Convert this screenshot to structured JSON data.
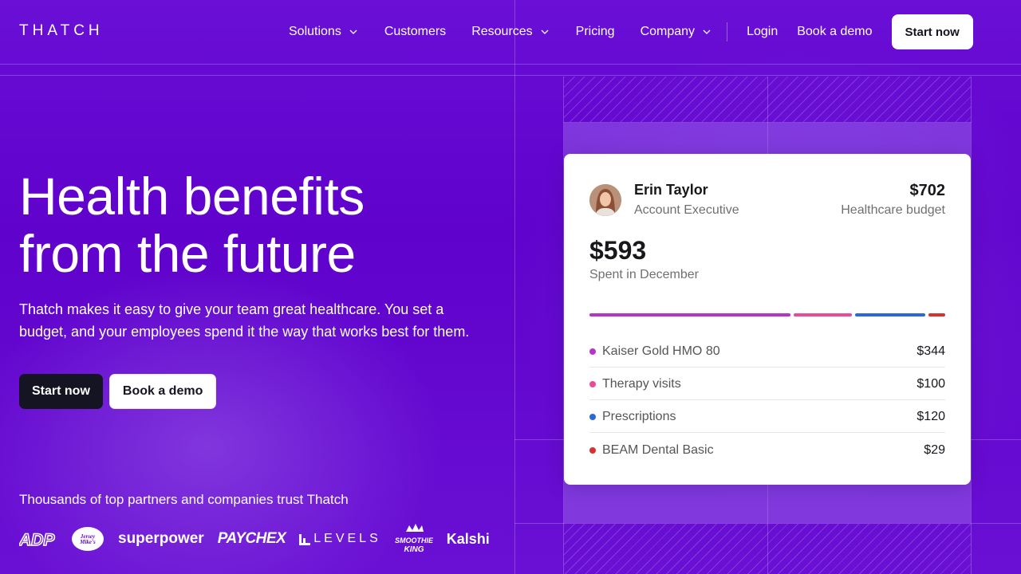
{
  "header": {
    "logo": "THATCH",
    "nav": [
      {
        "label": "Solutions",
        "dropdown": true
      },
      {
        "label": "Customers",
        "dropdown": false
      },
      {
        "label": "Resources",
        "dropdown": true
      },
      {
        "label": "Pricing",
        "dropdown": false
      },
      {
        "label": "Company",
        "dropdown": true
      }
    ],
    "login": "Login",
    "book_demo": "Book a demo",
    "start_now": "Start now"
  },
  "hero": {
    "title_line1": "Health benefits",
    "title_line2": "from the future",
    "subtitle": "Thatch makes it easy to give your team great healthcare. You set a budget, and your employees spend it the way that works best for them.",
    "primary_cta": "Start now",
    "secondary_cta": "Book a demo"
  },
  "trust": {
    "text": "Thousands of top partners and companies trust Thatch",
    "logos": [
      "ADP",
      "Jersey Mike's Subs",
      "superpower",
      "PAYCHEX",
      "LEVELS",
      "Smoothie King",
      "Kalshi"
    ]
  },
  "card": {
    "name": "Erin Taylor",
    "role": "Account Executive",
    "budget_value": "$702",
    "budget_label": "Healthcare budget",
    "spent_value": "$593",
    "spent_label": "Spent in December",
    "items": [
      {
        "label": "Kaiser Gold HMO 80",
        "value": "$344",
        "amount": 344,
        "color": "#b535c9"
      },
      {
        "label": "Therapy visits",
        "value": "$100",
        "amount": 100,
        "color": "#e64c97"
      },
      {
        "label": "Prescriptions",
        "value": "$120",
        "amount": 120,
        "color": "#2c66d8"
      },
      {
        "label": "BEAM Dental Basic",
        "value": "$29",
        "amount": 29,
        "color": "#d63232"
      }
    ]
  },
  "colors": {
    "brand_purple": "#6406d0",
    "dark_button": "#151423"
  }
}
